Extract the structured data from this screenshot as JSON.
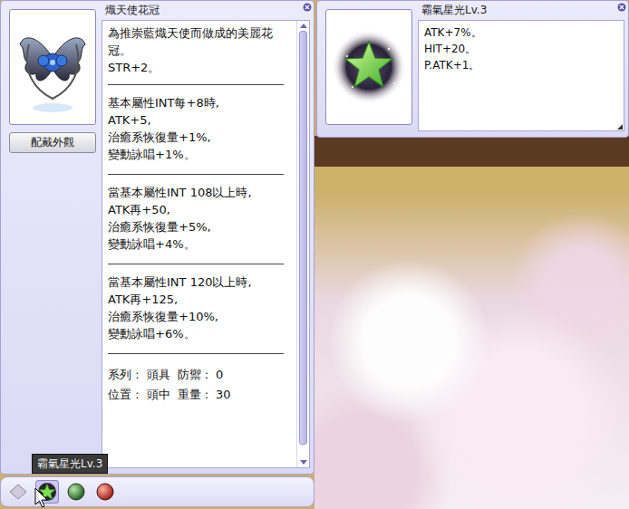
{
  "item_window": {
    "title": "熾天使花冠",
    "button": "配戴外觀",
    "description": [
      "為推崇藍熾天使而做成的美麗花冠。",
      "STR+2。"
    ],
    "sections": [
      [
        "基本屬性INT每+8時,",
        "ATK+5,",
        "治癒系恢復量+1%,",
        "變動詠唱+1%。"
      ],
      [
        "當基本屬性INT 108以上時,",
        "ATK再+50,",
        "治癒系恢復量+5%,",
        "變動詠唱+4%。"
      ],
      [
        "當基本屬性INT 120以上時,",
        "ATK再+125,",
        "治癒系恢復量+10%,",
        "變動詠唱+6%。"
      ]
    ],
    "footer": [
      [
        "系列 :",
        "頭具",
        "防禦 :",
        "0"
      ],
      [
        "位置 :",
        "頭中",
        "重量 :",
        "30"
      ]
    ],
    "scrollbar": {
      "level": 0.97
    }
  },
  "skill_window": {
    "title": "霸氣星光Lv.3",
    "lines": [
      "ATK+7%。",
      "HIT+20。",
      "P.ATK+1。"
    ]
  },
  "hotbar": {
    "slots": [
      {
        "kind": "diamond",
        "selected": false
      },
      {
        "kind": "star",
        "selected": true
      },
      {
        "kind": "green-orb",
        "selected": false
      },
      {
        "kind": "red-orb",
        "selected": false
      }
    ],
    "tooltip": "霸氣星光Lv.3"
  }
}
